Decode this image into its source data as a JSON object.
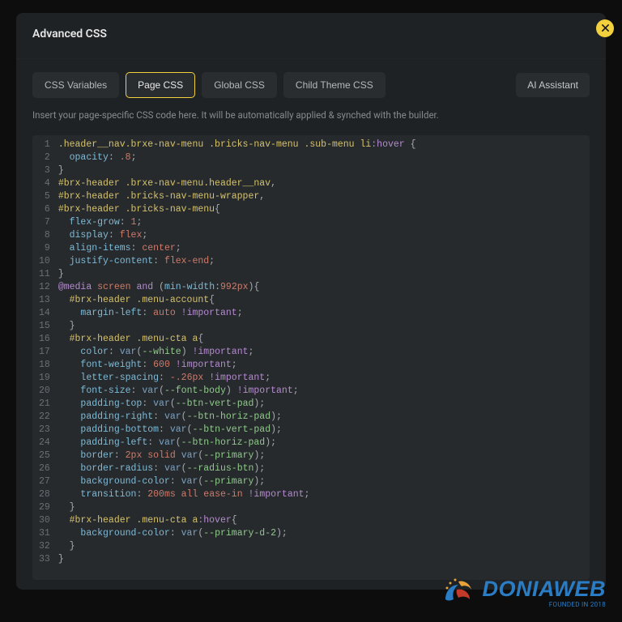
{
  "header": {
    "title": "Advanced CSS"
  },
  "tabs": [
    {
      "label": "CSS Variables",
      "active": false
    },
    {
      "label": "Page CSS",
      "active": true
    },
    {
      "label": "Global CSS",
      "active": false
    },
    {
      "label": "Child Theme CSS",
      "active": false
    }
  ],
  "ai_button": "AI Assistant",
  "instruction": "Insert your page-specific CSS code here. It will be automatically applied & synched with the builder.",
  "watermark": {
    "main": "DONIAWEB",
    "sub": "FOUNDED IN 2018"
  },
  "code": [
    [
      [
        "sel",
        ".header__nav.brxe-nav-menu .bricks-nav-menu .sub-menu li"
      ],
      [
        "pseudo",
        ":hover"
      ],
      [
        "punct",
        " "
      ],
      [
        "brace",
        "{"
      ]
    ],
    [
      [
        "prop",
        "  opacity"
      ],
      [
        "punct",
        ": "
      ],
      [
        "num",
        ".8"
      ],
      [
        "punct",
        ";"
      ]
    ],
    [
      [
        "brace",
        "}"
      ]
    ],
    [
      [
        "sel",
        "#brx-header .brxe-nav-menu.header__nav"
      ],
      [
        "punct",
        ","
      ]
    ],
    [
      [
        "sel",
        "#brx-header .bricks-nav-menu-wrapper"
      ],
      [
        "punct",
        ","
      ]
    ],
    [
      [
        "sel",
        "#brx-header .bricks-nav-menu"
      ],
      [
        "brace",
        "{"
      ]
    ],
    [
      [
        "prop",
        "  flex-grow"
      ],
      [
        "punct",
        ": "
      ],
      [
        "num",
        "1"
      ],
      [
        "punct",
        ";"
      ]
    ],
    [
      [
        "prop",
        "  display"
      ],
      [
        "punct",
        ": "
      ],
      [
        "val",
        "flex"
      ],
      [
        "punct",
        ";"
      ]
    ],
    [
      [
        "prop",
        "  align-items"
      ],
      [
        "punct",
        ": "
      ],
      [
        "val",
        "center"
      ],
      [
        "punct",
        ";"
      ]
    ],
    [
      [
        "prop",
        "  justify-content"
      ],
      [
        "punct",
        ": "
      ],
      [
        "val",
        "flex-end"
      ],
      [
        "punct",
        ";"
      ]
    ],
    [
      [
        "brace",
        "}"
      ]
    ],
    [
      [
        "at",
        "@media"
      ],
      [
        "punct",
        " "
      ],
      [
        "val",
        "screen"
      ],
      [
        "punct",
        " "
      ],
      [
        "kw2",
        "and"
      ],
      [
        "punct",
        " ("
      ],
      [
        "prop",
        "min-width"
      ],
      [
        "punct",
        ":"
      ],
      [
        "num",
        "992px"
      ],
      [
        "punct",
        ")"
      ],
      [
        "brace",
        "{"
      ]
    ],
    [
      [
        "sel",
        "  #brx-header .menu-account"
      ],
      [
        "brace",
        "{"
      ]
    ],
    [
      [
        "prop",
        "    margin-left"
      ],
      [
        "punct",
        ": "
      ],
      [
        "val",
        "auto"
      ],
      [
        "punct",
        " "
      ],
      [
        "imp",
        "!important"
      ],
      [
        "punct",
        ";"
      ]
    ],
    [
      [
        "brace",
        "  }"
      ]
    ],
    [
      [
        "sel",
        "  #brx-header .menu-cta a"
      ],
      [
        "brace",
        "{"
      ]
    ],
    [
      [
        "prop",
        "    color"
      ],
      [
        "punct",
        ": "
      ],
      [
        "fn",
        "var"
      ],
      [
        "punct",
        "("
      ],
      [
        "var",
        "--white"
      ],
      [
        "punct",
        ") "
      ],
      [
        "imp",
        "!important"
      ],
      [
        "punct",
        ";"
      ]
    ],
    [
      [
        "prop",
        "    font-weight"
      ],
      [
        "punct",
        ": "
      ],
      [
        "num",
        "600"
      ],
      [
        "punct",
        " "
      ],
      [
        "imp",
        "!important"
      ],
      [
        "punct",
        ";"
      ]
    ],
    [
      [
        "prop",
        "    letter-spacing"
      ],
      [
        "punct",
        ": "
      ],
      [
        "num",
        "-.26px"
      ],
      [
        "punct",
        " "
      ],
      [
        "imp",
        "!important"
      ],
      [
        "punct",
        ";"
      ]
    ],
    [
      [
        "prop",
        "    font-size"
      ],
      [
        "punct",
        ": "
      ],
      [
        "fn",
        "var"
      ],
      [
        "punct",
        "("
      ],
      [
        "var",
        "--font-body"
      ],
      [
        "punct",
        ") "
      ],
      [
        "imp",
        "!important"
      ],
      [
        "punct",
        ";"
      ]
    ],
    [
      [
        "prop",
        "    padding-top"
      ],
      [
        "punct",
        ": "
      ],
      [
        "fn",
        "var"
      ],
      [
        "punct",
        "("
      ],
      [
        "var",
        "--btn-vert-pad"
      ],
      [
        "punct",
        ");"
      ]
    ],
    [
      [
        "prop",
        "    padding-right"
      ],
      [
        "punct",
        ": "
      ],
      [
        "fn",
        "var"
      ],
      [
        "punct",
        "("
      ],
      [
        "var",
        "--btn-horiz-pad"
      ],
      [
        "punct",
        ");"
      ]
    ],
    [
      [
        "prop",
        "    padding-bottom"
      ],
      [
        "punct",
        ": "
      ],
      [
        "fn",
        "var"
      ],
      [
        "punct",
        "("
      ],
      [
        "var",
        "--btn-vert-pad"
      ],
      [
        "punct",
        ");"
      ]
    ],
    [
      [
        "prop",
        "    padding-left"
      ],
      [
        "punct",
        ": "
      ],
      [
        "fn",
        "var"
      ],
      [
        "punct",
        "("
      ],
      [
        "var",
        "--btn-horiz-pad"
      ],
      [
        "punct",
        ");"
      ]
    ],
    [
      [
        "prop",
        "    border"
      ],
      [
        "punct",
        ": "
      ],
      [
        "num",
        "2px"
      ],
      [
        "punct",
        " "
      ],
      [
        "val",
        "solid"
      ],
      [
        "punct",
        " "
      ],
      [
        "fn",
        "var"
      ],
      [
        "punct",
        "("
      ],
      [
        "var",
        "--primary"
      ],
      [
        "punct",
        ");"
      ]
    ],
    [
      [
        "prop",
        "    border-radius"
      ],
      [
        "punct",
        ": "
      ],
      [
        "fn",
        "var"
      ],
      [
        "punct",
        "("
      ],
      [
        "var",
        "--radius-btn"
      ],
      [
        "punct",
        ");"
      ]
    ],
    [
      [
        "prop",
        "    background-color"
      ],
      [
        "punct",
        ": "
      ],
      [
        "fn",
        "var"
      ],
      [
        "punct",
        "("
      ],
      [
        "var",
        "--primary"
      ],
      [
        "punct",
        ");"
      ]
    ],
    [
      [
        "prop",
        "    transition"
      ],
      [
        "punct",
        ": "
      ],
      [
        "num",
        "200ms"
      ],
      [
        "punct",
        " "
      ],
      [
        "val",
        "all"
      ],
      [
        "punct",
        " "
      ],
      [
        "val",
        "ease-in"
      ],
      [
        "punct",
        " "
      ],
      [
        "imp",
        "!important"
      ],
      [
        "punct",
        ";"
      ]
    ],
    [
      [
        "brace",
        "  }"
      ]
    ],
    [
      [
        "sel",
        "  #brx-header .menu-cta a"
      ],
      [
        "pseudo",
        ":hover"
      ],
      [
        "brace",
        "{"
      ]
    ],
    [
      [
        "prop",
        "    background-color"
      ],
      [
        "punct",
        ": "
      ],
      [
        "fn",
        "var"
      ],
      [
        "punct",
        "("
      ],
      [
        "var",
        "--primary-d-2"
      ],
      [
        "punct",
        ");"
      ]
    ],
    [
      [
        "brace",
        "  }"
      ]
    ],
    [
      [
        "brace",
        "}"
      ]
    ]
  ]
}
